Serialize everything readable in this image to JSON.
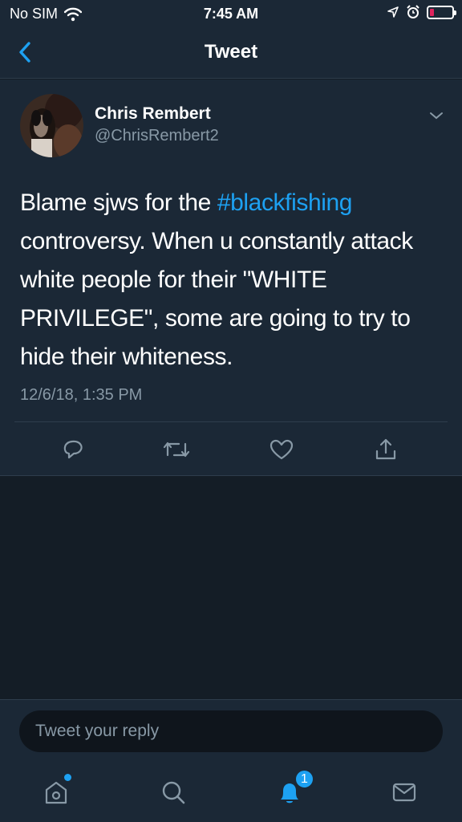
{
  "status_bar": {
    "carrier": "No SIM",
    "time": "7:45 AM",
    "battery_color": "#e0245e"
  },
  "nav": {
    "title": "Tweet",
    "back_icon": "chevron-left-icon"
  },
  "tweet": {
    "author_name": "Chris Rembert",
    "author_handle": "@ChrisRembert2",
    "text_before": "Blame sjws for the ",
    "hashtag": "#blackfishing",
    "text_after": " controversy. When u constantly attack white people for their \"WHITE PRIVILEGE\", some are going to try to hide their whiteness.",
    "timestamp": "12/6/18, 1:35 PM",
    "actions": [
      "reply-icon",
      "retweet-icon",
      "like-icon",
      "share-icon"
    ]
  },
  "composer": {
    "placeholder": "Tweet your reply"
  },
  "tabbar": {
    "tabs": [
      "home-icon",
      "search-icon",
      "notifications-icon",
      "messages-icon"
    ],
    "notification_count": "1"
  },
  "colors": {
    "accent": "#1da1f2",
    "background": "#141d26",
    "panel": "#1b2836",
    "secondary_text": "#8899a6"
  }
}
